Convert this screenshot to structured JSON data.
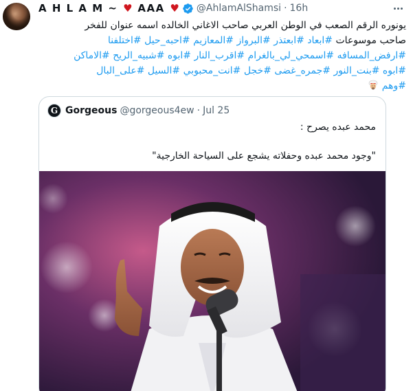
{
  "tweet": {
    "display_name_prefix": "A H L A M ~",
    "heart": "♥",
    "display_name_aaa": "AAA",
    "handle": "@AhlamAlShamsi",
    "separator": "·",
    "time": "16h",
    "text_line1": "يونوره الرقم الصعب في الوطن العربي صاحب الاغاني الخالده اسمه عنوان للفخر",
    "text_line2_plain": "صاحب موسوعات",
    "line2_tags": [
      "#ابعاد",
      "#ابعتذر",
      "#البرواز",
      "#المعازيم",
      "#احبه_حيل",
      "#اختلفنا"
    ],
    "line3_tags": [
      "#ارفض_المسافه",
      "#اسمحي_لي_بالغرام",
      "#اقرب_النار",
      "#ابوه",
      "#شبيه_الريح",
      "#الاماكن"
    ],
    "line4_tags": [
      "#ابوه",
      "#بنت_النور",
      "#جمره_غضى",
      "#خجل",
      "#انت_محبوبي",
      "#السيل",
      "#على_البال"
    ],
    "line5_tags": [
      "#وهم"
    ],
    "emoji": "man-with-turban-emoji"
  },
  "quote": {
    "avatar_letter": "G",
    "name": "Gorgeous",
    "handle": "@gorgeous4ew",
    "separator": "·",
    "date": "Jul 25",
    "text_line1": "محمد عبده يصرح :",
    "text_line2": "\"وجود محمد عبده وحفلاته يشجع على السياحة الخارجية\"",
    "image": "photo-of-singer-in-white-ghutra-with-microphone"
  },
  "colors": {
    "hashtag": "#1d9bf0",
    "secondary": "#536471",
    "heart": "#d0161f",
    "verified": "#1d9bf0",
    "border": "#cfd9de"
  },
  "icons": {
    "verified": "verified-badge-icon",
    "more": "more-options-icon"
  }
}
